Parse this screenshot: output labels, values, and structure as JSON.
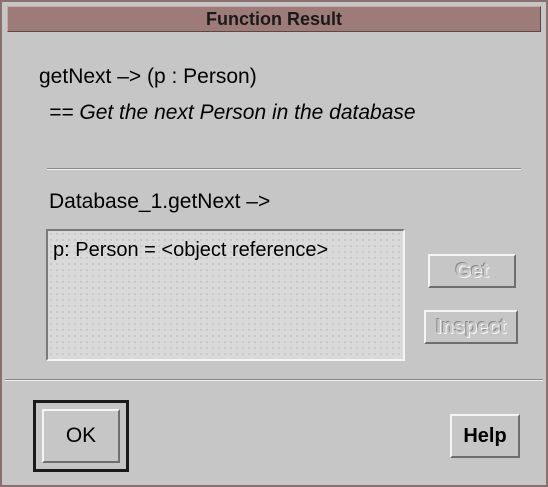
{
  "window": {
    "title": "Function Result"
  },
  "function": {
    "signature": "getNext –> (p : Person)",
    "description": "== Get the next Person in the database"
  },
  "call": {
    "name": "Database_1.getNext –>",
    "results": [
      "p: Person = <object reference>"
    ]
  },
  "buttons": {
    "get": "Get",
    "inspect": "Inspect",
    "ok": "OK",
    "help": "Help"
  }
}
